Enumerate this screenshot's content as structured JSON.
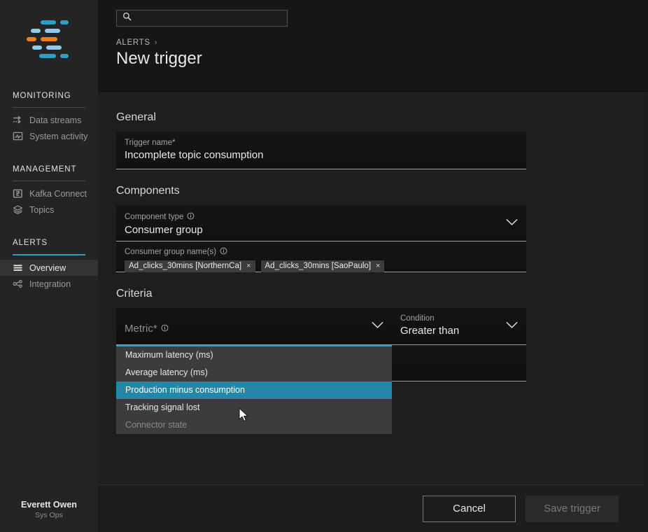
{
  "brand": {
    "logo_name": "lenses-logo",
    "colors": {
      "blue": "#2e9fc4",
      "light_blue": "#8fc8e8",
      "orange": "#f07d1a",
      "accent": "#2586a8"
    }
  },
  "sidebar": {
    "groups": [
      {
        "heading": "MONITORING",
        "active": false,
        "items": [
          {
            "label": "Data streams",
            "icon": "data-streams-icon",
            "selected": false
          },
          {
            "label": "System activity",
            "icon": "system-activity-icon",
            "selected": false
          }
        ]
      },
      {
        "heading": "MANAGEMENT",
        "active": false,
        "items": [
          {
            "label": "Kafka Connect",
            "icon": "kafka-connect-icon",
            "selected": false
          },
          {
            "label": "Topics",
            "icon": "topics-icon",
            "selected": false
          }
        ]
      },
      {
        "heading": "ALERTS",
        "active": true,
        "items": [
          {
            "label": "Overview",
            "icon": "overview-icon",
            "selected": true
          },
          {
            "label": "Integration",
            "icon": "integration-icon",
            "selected": false
          }
        ]
      }
    ],
    "user": {
      "name": "Everett Owen",
      "role": "Sys Ops"
    }
  },
  "topbar": {
    "search": {
      "value": "",
      "placeholder": "",
      "icon": "search-icon"
    },
    "breadcrumb": {
      "parent": "ALERTS",
      "separator": "›"
    },
    "title": "New trigger"
  },
  "general": {
    "section_title": "General",
    "trigger_name": {
      "label": "Trigger name*",
      "value": "Incomplete topic consumption"
    }
  },
  "components": {
    "section_title": "Components",
    "component_type": {
      "label": "Component type",
      "value": "Consumer group",
      "info_icon": "info-icon",
      "chevron": "chevron-down-icon"
    },
    "consumer_groups": {
      "label": "Consumer group name(s)",
      "info_icon": "info-icon",
      "chips": [
        {
          "text": "Ad_clicks_30mins [NorthernCa]",
          "remove": "×"
        },
        {
          "text": "Ad_clicks_30mins [SaoPaulo]",
          "remove": "×"
        }
      ]
    }
  },
  "criteria": {
    "section_title": "Criteria",
    "metric": {
      "label": "Metric*",
      "value": "",
      "placeholder": "Metric*",
      "info_icon": "info-icon",
      "chevron": "chevron-down-icon",
      "open": true
    },
    "condition": {
      "label": "Condition",
      "value": "Greater than",
      "chevron": "chevron-down-icon"
    },
    "value_field": {
      "label": "",
      "value": ""
    },
    "metric_options": [
      {
        "label": "Maximum latency (ms)",
        "state": "normal"
      },
      {
        "label": "Average latency (ms)",
        "state": "normal"
      },
      {
        "label": "Production minus consumption",
        "state": "highlighted"
      },
      {
        "label": "Tracking signal lost",
        "state": "normal"
      },
      {
        "label": "Connector state",
        "state": "disabled"
      }
    ]
  },
  "footer": {
    "cancel_label": "Cancel",
    "save_label": "Save trigger"
  }
}
